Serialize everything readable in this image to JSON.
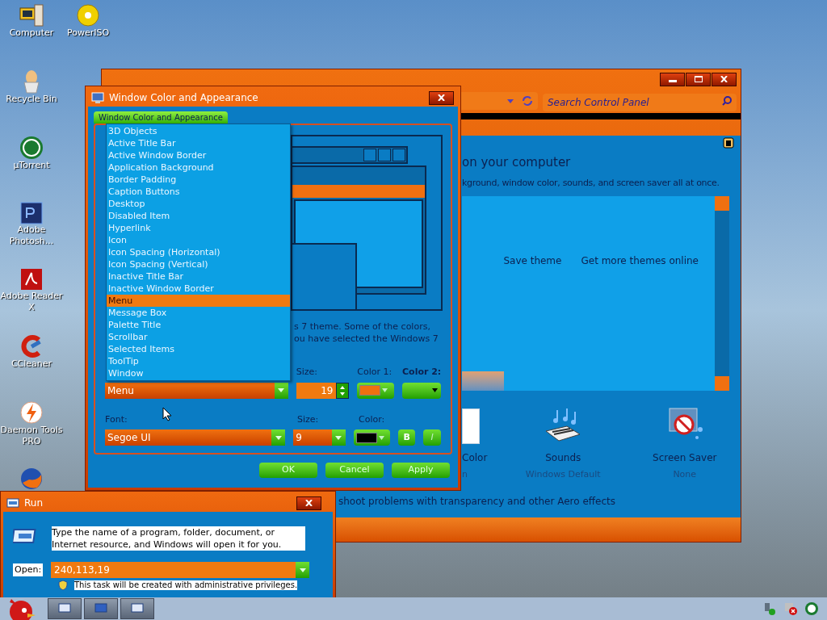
{
  "desktop_icons": [
    {
      "label": "Computer",
      "kind": "computer"
    },
    {
      "label": "Recycle Bin",
      "kind": "bin"
    },
    {
      "label": "µTorrent",
      "kind": "torrent"
    },
    {
      "label": "Adobe Photosh...",
      "kind": "ps"
    },
    {
      "label": "Adobe Reader X",
      "kind": "pdf"
    },
    {
      "label": "CCleaner",
      "kind": "cleaner"
    },
    {
      "label": "Daemon Tools PRO",
      "kind": "bolt"
    },
    {
      "kind": "browser"
    }
  ],
  "desktop_icons_column_2": [
    {
      "label": "PowerISO",
      "kind": "disc"
    }
  ],
  "control_panel": {
    "search": {
      "placeholder": "Search Control Panel"
    },
    "heading": "on your computer",
    "description": "kground, window color, sounds, and screen saver all at once.",
    "theme_links": [
      "Save theme",
      "Get more themes online"
    ],
    "items": [
      {
        "label": "Color",
        "value": "n",
        "kind": "color"
      },
      {
        "label": "Sounds",
        "value": "Windows Default",
        "kind": "sounds"
      },
      {
        "label": "Screen Saver",
        "value": "None",
        "kind": "saver"
      }
    ],
    "footer_link": "shoot problems with transparency and other Aero effects"
  },
  "appearance_dialog": {
    "title": "Window Color and Appearance",
    "tab": "Window Color and Appearance",
    "note_lines": [
      "s 7 theme.  Some of the colors,",
      "ou have selected the Windows 7"
    ],
    "item_list": [
      {
        "label": "3D Objects",
        "selected": false
      },
      {
        "label": "Active Title Bar",
        "selected": false
      },
      {
        "label": "Active Window Border",
        "selected": false
      },
      {
        "label": "Application Background",
        "selected": false
      },
      {
        "label": "Border Padding",
        "selected": false
      },
      {
        "label": "Caption Buttons",
        "selected": false
      },
      {
        "label": "Desktop",
        "selected": false
      },
      {
        "label": "Disabled Item",
        "selected": false
      },
      {
        "label": "Hyperlink",
        "selected": false
      },
      {
        "label": "Icon",
        "selected": false
      },
      {
        "label": "Icon Spacing (Horizontal)",
        "selected": false
      },
      {
        "label": "Icon Spacing (Vertical)",
        "selected": false
      },
      {
        "label": "Inactive Title Bar",
        "selected": false
      },
      {
        "label": "Inactive Window Border",
        "selected": false
      },
      {
        "label": "Menu",
        "selected": true
      },
      {
        "label": "Message Box",
        "selected": false
      },
      {
        "label": "Palette Title",
        "selected": false
      },
      {
        "label": "Scrollbar",
        "selected": false
      },
      {
        "label": "Selected Items",
        "selected": false
      },
      {
        "label": "ToolTip",
        "selected": false
      },
      {
        "label": "Window",
        "selected": false
      }
    ],
    "item_value": "Menu",
    "size_label": "Size:",
    "size_value": "19",
    "color1_label": "Color 1:",
    "color2_label": "Color 2:",
    "font_label": "Font:",
    "font_value": "Segoe UI",
    "font_size_label": "Size:",
    "font_size_value": "9",
    "font_color_label": "Color:",
    "bold_label": "B",
    "italic_label": "I",
    "buttons": [
      "OK",
      "Cancel",
      "Apply"
    ]
  },
  "run_dialog": {
    "title": "Run",
    "message": "Type the name of a program, folder, document, or Internet resource, and Windows will open it for you.",
    "open_label": "Open:",
    "open_value": "240,113,19",
    "admin_note": "This task will be created with administrative privileges."
  }
}
